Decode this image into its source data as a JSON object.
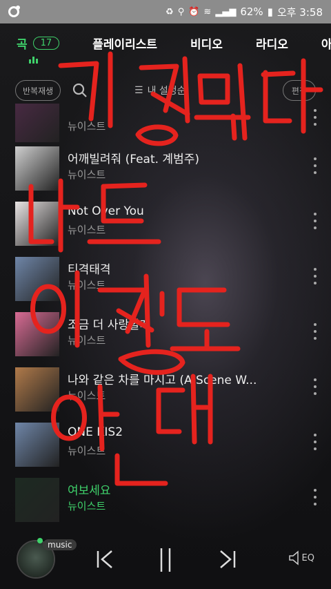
{
  "status_bar": {
    "battery": "62%",
    "time": "오후 3:58"
  },
  "tabs": [
    {
      "label": "곡",
      "badge": "17",
      "active": true
    },
    {
      "label": "플레이리스트"
    },
    {
      "label": "비디오"
    },
    {
      "label": "라디오"
    },
    {
      "label": "아"
    }
  ],
  "toolbar": {
    "repeat_label": "반복재생",
    "sort_label": "내 설정순",
    "edit_label": "편집"
  },
  "songs": [
    {
      "title": "",
      "artist": "뉴이스트",
      "cover": "#4a2a44"
    },
    {
      "title": "어깨빌려줘 (Feat. 계범주)",
      "artist": "뉴이스트",
      "cover": "#cfcfcf"
    },
    {
      "title": "Not Over You",
      "artist": "뉴이스트",
      "cover": "#e9e4e4"
    },
    {
      "title": "티격태격",
      "artist": "뉴이스트",
      "cover": "#6f86a8"
    },
    {
      "title": "조금 더 사랑할게",
      "artist": "뉴이스트",
      "cover": "#d86b94"
    },
    {
      "title": "나와 같은 차를 마시고 (A Scene W...",
      "artist": "뉴이스트",
      "cover": "#b07a4a"
    },
    {
      "title": "ONE KIS2",
      "artist": "뉴이스트",
      "cover": "#6f86a8"
    },
    {
      "title": "여보세요",
      "artist": "뉴이스트",
      "cover": "#1d2a22",
      "playing": true
    }
  ],
  "player": {
    "tag": "music",
    "eq_label": "EQ"
  },
  "handwriting": {
    "text": "긴장된다 나도 이정도 인데",
    "color": "#e5231e"
  }
}
